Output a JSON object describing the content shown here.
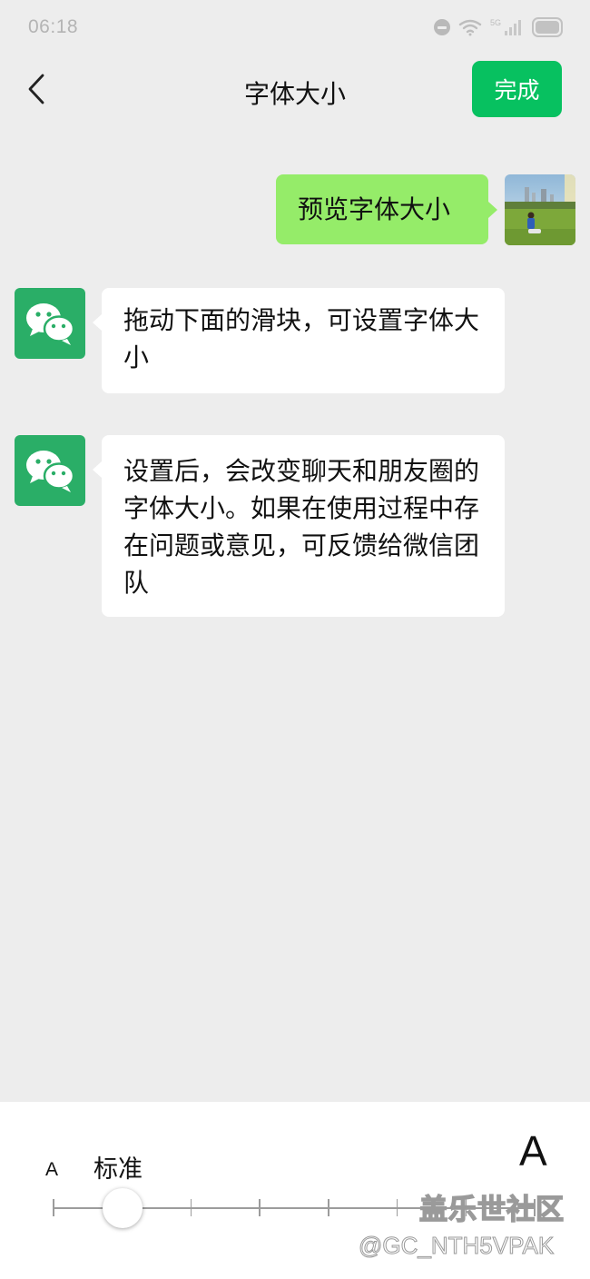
{
  "status_bar": {
    "time": "06:18",
    "network_label": "5G",
    "icons": [
      "do-not-disturb-icon",
      "wifi-icon",
      "signal-icon",
      "battery-icon"
    ]
  },
  "nav": {
    "back_icon": "chevron-left-icon",
    "title": "字体大小",
    "done_label": "完成"
  },
  "messages": [
    {
      "from": "me",
      "text": "预览字体大小",
      "avatar": "photo-avatar"
    },
    {
      "from": "wechat",
      "text": "拖动下面的滑块，可设置字体大小",
      "avatar": "wechat-logo"
    },
    {
      "from": "wechat",
      "text": "设置后，会改变聊天和朋友圈的字体大小。如果在使用过程中存在问题或意见，可反馈给微信团队",
      "avatar": "wechat-logo"
    }
  ],
  "font_slider": {
    "small_label": "A",
    "large_label": "A",
    "current_label": "标准",
    "levels": 8,
    "selected_index": 1
  },
  "watermark": {
    "line1": "盖乐世社区",
    "line2": "@GC_NTH5VPAK"
  },
  "colors": {
    "background": "#ededed",
    "accent_green": "#07c160",
    "my_bubble": "#95ec69",
    "other_bubble": "#ffffff"
  }
}
